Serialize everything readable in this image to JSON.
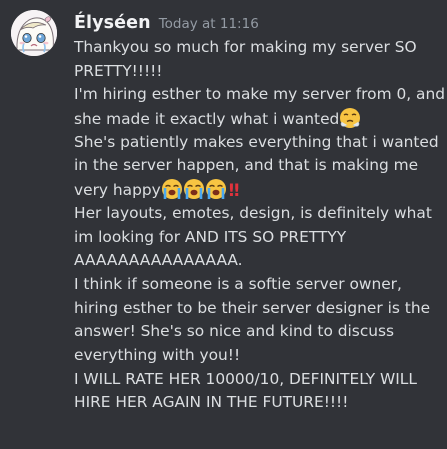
{
  "message": {
    "username": "Élyséen",
    "timestamp": "Today at 11:16",
    "lines": [
      "Thankyou so much for making my server SO",
      "PRETTY!!!!!",
      "I'm hiring esther to make my server from 0, and",
      "she made it exactly what i wanted",
      "She's patiently makes everything that i wanted",
      "in the server happen, and that is making me",
      "very happy",
      "Her layouts, emotes, design, is definitely what",
      "im looking for AND ITS SO PRETTYY",
      "AAAAAAAAAAAAAAA.",
      "I think if someone is a softie server owner,",
      "hiring esther to be their server designer is the",
      "answer! She's so nice and kind to discuss",
      "everything with you!!",
      "I WILL RATE HER 10000/10, DEFINITELY WILL",
      "HIRE HER AGAIN IN THE FUTURE!!!!"
    ],
    "emojis": {
      "line4": "face-with-steam-emoji",
      "line7": [
        "loudly-crying-face-emoji",
        "loudly-crying-face-emoji",
        "loudly-crying-face-emoji",
        "double-exclamation-emoji"
      ]
    },
    "double_exclamation": "‼"
  },
  "colors": {
    "background": "#313338",
    "username": "#f2f3f5",
    "timestamp": "#949ba4",
    "text": "#dbdee1",
    "exclamation": "#e0323c"
  }
}
